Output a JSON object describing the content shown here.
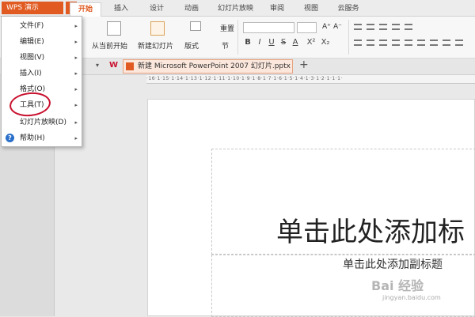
{
  "app": {
    "name": "WPS 演示",
    "accent": "#e05a21"
  },
  "tabs": [
    {
      "label": "开始"
    },
    {
      "label": "插入"
    },
    {
      "label": "设计"
    },
    {
      "label": "动画"
    },
    {
      "label": "幻灯片放映"
    },
    {
      "label": "审阅"
    },
    {
      "label": "视图"
    },
    {
      "label": "云服务"
    }
  ],
  "ribbon": {
    "from_current": "从当前开始",
    "new_slide": "新建幻灯片",
    "layout": "版式",
    "reset": "重置",
    "section": "节",
    "format_buttons": [
      "B",
      "I",
      "U",
      "S",
      "A",
      "X²",
      "X₂"
    ],
    "font_size_buttons": [
      "A⁺",
      "A⁻"
    ]
  },
  "document": {
    "tab_title": "新建 Microsoft PowerPoint 2007 幻灯片.pptx *",
    "new_tab": "+"
  },
  "ruler": {
    "text": "·16·1·15·1·14·1·13·1·12·1·11·1·10·1·9·1·8·1·7·1·6·1·5·1·4·1·3·1·2·1·1·1·"
  },
  "slide": {
    "title": "单击此处添加标",
    "subtitle": "单击此处添加副标题"
  },
  "menu": {
    "items": [
      {
        "label": "文件(F)"
      },
      {
        "label": "编辑(E)"
      },
      {
        "label": "视图(V)"
      },
      {
        "label": "插入(I)"
      },
      {
        "label": "格式(O)"
      },
      {
        "label": "工具(T)"
      },
      {
        "label": "幻灯片放映(D)"
      },
      {
        "label": "帮助(H)"
      }
    ]
  },
  "watermark": {
    "brand": "Bai 经验",
    "url": "jingyan.baidu.com"
  },
  "icons": {
    "dropdown_arrow": "▾",
    "submenu_arrow": "▸",
    "help": "?",
    "wps_logo": "W"
  }
}
